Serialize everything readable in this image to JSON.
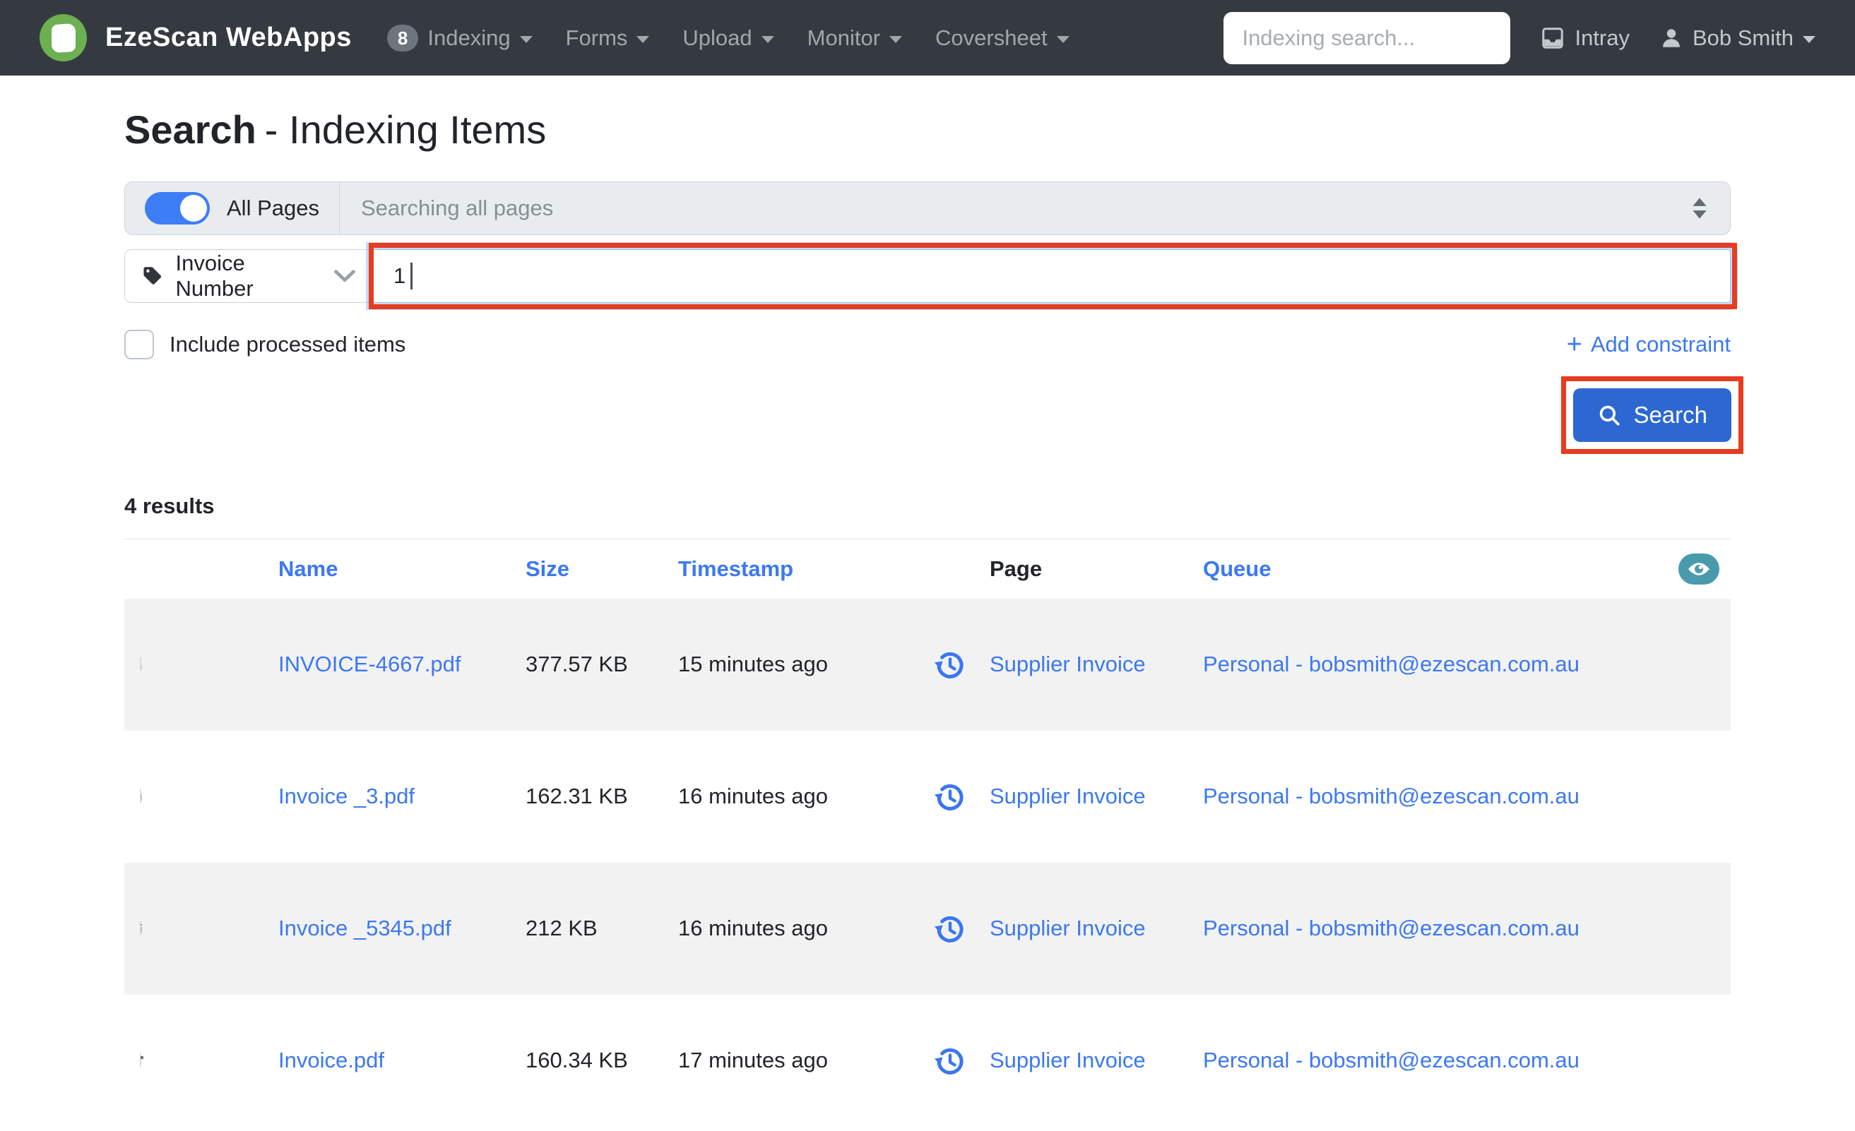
{
  "navbar": {
    "brand": "EzeScan WebApps",
    "items": [
      {
        "label": "Indexing",
        "badge": "8"
      },
      {
        "label": "Forms"
      },
      {
        "label": "Upload"
      },
      {
        "label": "Monitor"
      },
      {
        "label": "Coversheet"
      }
    ],
    "search_placeholder": "Indexing search...",
    "intray_label": "Intray",
    "user_name": "Bob Smith"
  },
  "page": {
    "title_main": "Search",
    "title_sub": "- Indexing Items"
  },
  "filters": {
    "all_pages_label": "All Pages",
    "scope_value": "Searching all pages",
    "field_selector_value": "Invoice Number",
    "query_value": "1",
    "include_processed_label": "Include processed items",
    "add_constraint_label": "Add constraint",
    "search_button_label": "Search"
  },
  "results": {
    "count_text": "4 results",
    "columns": {
      "name": "Name",
      "size": "Size",
      "timestamp": "Timestamp",
      "page": "Page",
      "queue": "Queue"
    },
    "rows": [
      {
        "name": "INVOICE-4667.pdf",
        "size": "377.57 KB",
        "timestamp": "15 minutes ago",
        "page": "Supplier Invoice",
        "queue": "Personal - bobsmith@ezescan.com.au"
      },
      {
        "name": "Invoice _3.pdf",
        "size": "162.31 KB",
        "timestamp": "16 minutes ago",
        "page": "Supplier Invoice",
        "queue": "Personal - bobsmith@ezescan.com.au"
      },
      {
        "name": "Invoice _5345.pdf",
        "size": "212 KB",
        "timestamp": "16 minutes ago",
        "page": "Supplier Invoice",
        "queue": "Personal - bobsmith@ezescan.com.au"
      },
      {
        "name": "Invoice.pdf",
        "size": "160.34 KB",
        "timestamp": "17 minutes ago",
        "page": "Supplier Invoice",
        "queue": "Personal - bobsmith@ezescan.com.au"
      }
    ]
  },
  "colors": {
    "navbar_bg": "#343a40",
    "brand_green": "#6cb052",
    "link_blue": "#3c78f2",
    "button_blue": "#2d68d2",
    "toggle_blue": "#3d7df6",
    "annotation_red": "#e63c1f",
    "eye_teal": "#4a9aae",
    "stripe_gray": "#f2f2f2"
  }
}
